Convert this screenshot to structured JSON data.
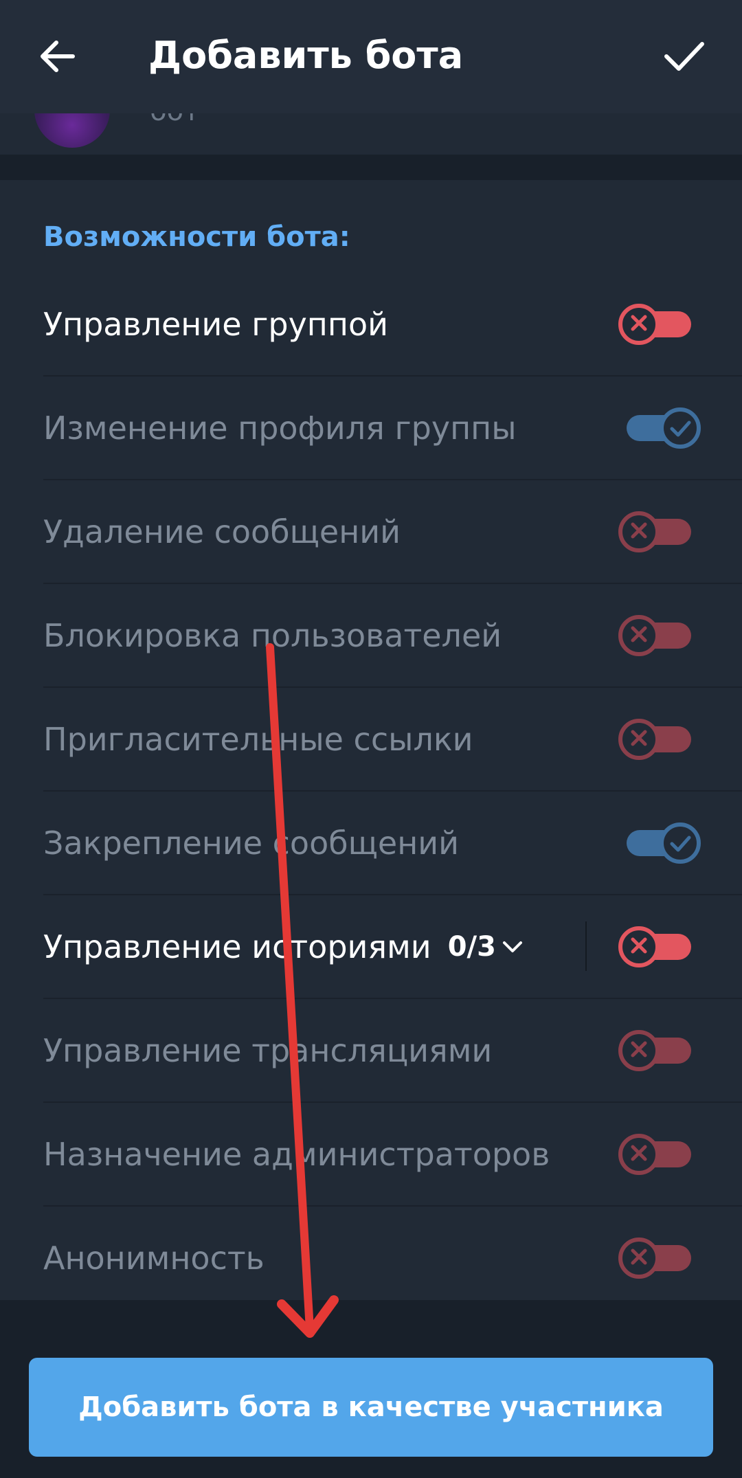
{
  "header": {
    "title": "Добавить бота",
    "back_icon": "arrow-left-icon",
    "done_icon": "checkmark-icon"
  },
  "profile": {
    "subtitle": "бот"
  },
  "permissions": {
    "section_title": "Возможности бота:",
    "items": [
      {
        "label": "Управление группой",
        "enabled": false,
        "active": true
      },
      {
        "label": "Изменение профиля группы",
        "enabled": true,
        "active": false
      },
      {
        "label": "Удаление сообщений",
        "enabled": false,
        "active": false
      },
      {
        "label": "Блокировка пользователей",
        "enabled": false,
        "active": false
      },
      {
        "label": "Пригласительные ссылки",
        "enabled": false,
        "active": false
      },
      {
        "label": "Закрепление сообщений",
        "enabled": true,
        "active": false
      },
      {
        "label": "Управление историями",
        "counter": "0/3",
        "enabled": false,
        "active": true
      },
      {
        "label": "Управление трансляциями",
        "enabled": false,
        "active": false
      },
      {
        "label": "Назначение администраторов",
        "enabled": false,
        "active": false
      },
      {
        "label": "Анонимность",
        "enabled": false,
        "active": false
      }
    ]
  },
  "footer": {
    "add_button_label": "Добавить бота в качестве участника"
  },
  "colors": {
    "accent": "#53a6ea",
    "section_title": "#62aef5",
    "toggle_off": "#e3565f",
    "toggle_on": "#3e6e9d",
    "annotation_arrow": "#e53935"
  }
}
